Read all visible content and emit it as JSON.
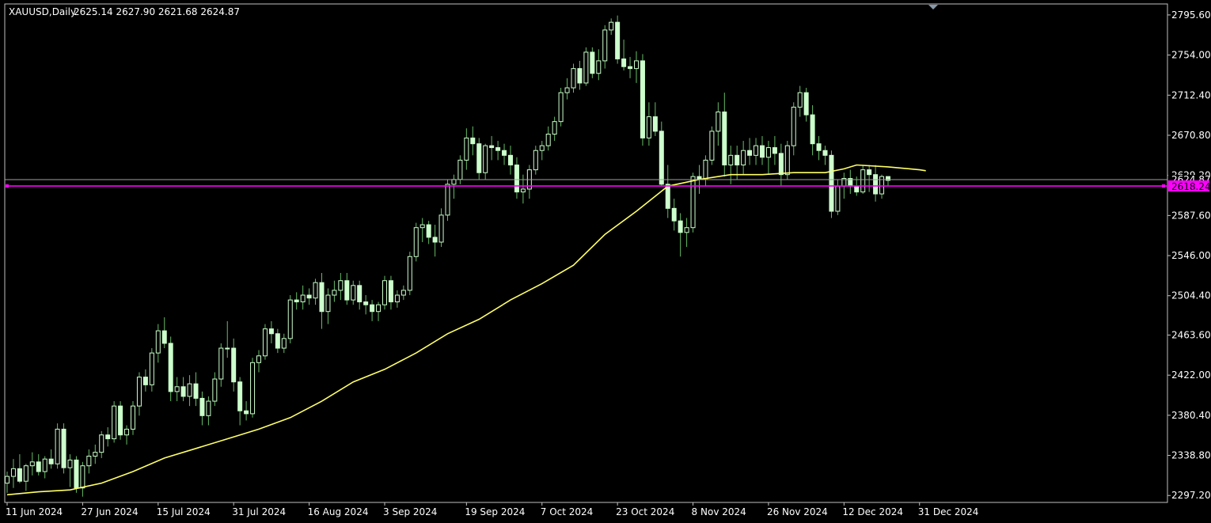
{
  "chart_data": {
    "type": "candlestick",
    "symbol": "XAUUSD",
    "timeframe": "Daily",
    "header_ohlc": {
      "open": "2625.14",
      "high": "2627.90",
      "low": "2621.68",
      "close": "2624.87"
    },
    "current_price": "2624.87",
    "horizontal_level": "2618.24",
    "y_ticks": [
      "2795.60",
      "2754.00",
      "2712.40",
      "2670.80",
      "2629.20",
      "2587.60",
      "2546.00",
      "2504.40",
      "2463.60",
      "2422.00",
      "2380.40",
      "2338.80",
      "2297.20"
    ],
    "x_ticks": [
      {
        "label": "11 Jun 2024",
        "index": 0
      },
      {
        "label": "27 Jun 2024",
        "index": 12
      },
      {
        "label": "15 Jul 2024",
        "index": 24
      },
      {
        "label": "31 Jul 2024",
        "index": 36
      },
      {
        "label": "16 Aug 2024",
        "index": 48
      },
      {
        "label": "3 Sep 2024",
        "index": 60
      },
      {
        "label": "19 Sep 2024",
        "index": 73
      },
      {
        "label": "7 Oct 2024",
        "index": 85
      },
      {
        "label": "23 Oct 2024",
        "index": 97
      },
      {
        "label": "8 Nov 2024",
        "index": 109
      },
      {
        "label": "26 Nov 2024",
        "index": 121
      },
      {
        "label": "12 Dec 2024",
        "index": 133
      },
      {
        "label": "31 Dec 2024",
        "index": 145
      }
    ],
    "ylim": [
      2290,
      2807
    ],
    "ohlc": [
      [
        2310,
        2322,
        2300,
        2317
      ],
      [
        2317,
        2335,
        2305,
        2325
      ],
      [
        2325,
        2340,
        2310,
        2312
      ],
      [
        2312,
        2330,
        2302,
        2328
      ],
      [
        2328,
        2342,
        2318,
        2332
      ],
      [
        2332,
        2340,
        2318,
        2322
      ],
      [
        2322,
        2338,
        2315,
        2335
      ],
      [
        2335,
        2345,
        2325,
        2330
      ],
      [
        2330,
        2372,
        2325,
        2366
      ],
      [
        2366,
        2372,
        2320,
        2326
      ],
      [
        2326,
        2340,
        2306,
        2334
      ],
      [
        2334,
        2338,
        2300,
        2305
      ],
      [
        2305,
        2332,
        2296,
        2328
      ],
      [
        2328,
        2345,
        2320,
        2338
      ],
      [
        2338,
        2350,
        2330,
        2342
      ],
      [
        2342,
        2364,
        2336,
        2360
      ],
      [
        2360,
        2368,
        2348,
        2356
      ],
      [
        2356,
        2395,
        2352,
        2390
      ],
      [
        2390,
        2395,
        2355,
        2360
      ],
      [
        2360,
        2370,
        2350,
        2366
      ],
      [
        2366,
        2395,
        2360,
        2390
      ],
      [
        2390,
        2425,
        2380,
        2420
      ],
      [
        2420,
        2428,
        2405,
        2412
      ],
      [
        2412,
        2450,
        2405,
        2445
      ],
      [
        2445,
        2475,
        2435,
        2468
      ],
      [
        2468,
        2482,
        2450,
        2455
      ],
      [
        2455,
        2462,
        2395,
        2405
      ],
      [
        2405,
        2420,
        2395,
        2410
      ],
      [
        2410,
        2420,
        2395,
        2400
      ],
      [
        2400,
        2422,
        2390,
        2413
      ],
      [
        2413,
        2425,
        2390,
        2398
      ],
      [
        2398,
        2405,
        2370,
        2380
      ],
      [
        2380,
        2400,
        2370,
        2395
      ],
      [
        2395,
        2425,
        2390,
        2418
      ],
      [
        2418,
        2455,
        2410,
        2450
      ],
      [
        2450,
        2478,
        2440,
        2450
      ],
      [
        2450,
        2460,
        2405,
        2415
      ],
      [
        2415,
        2420,
        2370,
        2385
      ],
      [
        2385,
        2395,
        2375,
        2382
      ],
      [
        2382,
        2440,
        2378,
        2435
      ],
      [
        2435,
        2448,
        2425,
        2442
      ],
      [
        2442,
        2475,
        2438,
        2470
      ],
      [
        2470,
        2478,
        2455,
        2465
      ],
      [
        2465,
        2470,
        2445,
        2450
      ],
      [
        2450,
        2465,
        2445,
        2460
      ],
      [
        2460,
        2505,
        2455,
        2500
      ],
      [
        2500,
        2508,
        2490,
        2498
      ],
      [
        2498,
        2515,
        2490,
        2505
      ],
      [
        2505,
        2512,
        2495,
        2502
      ],
      [
        2502,
        2522,
        2495,
        2518
      ],
      [
        2518,
        2528,
        2470,
        2488
      ],
      [
        2488,
        2512,
        2475,
        2505
      ],
      [
        2505,
        2520,
        2498,
        2510
      ],
      [
        2510,
        2528,
        2500,
        2520
      ],
      [
        2520,
        2528,
        2495,
        2500
      ],
      [
        2500,
        2520,
        2495,
        2515
      ],
      [
        2515,
        2520,
        2490,
        2498
      ],
      [
        2498,
        2505,
        2485,
        2495
      ],
      [
        2495,
        2500,
        2478,
        2488
      ],
      [
        2488,
        2498,
        2478,
        2495
      ],
      [
        2495,
        2525,
        2490,
        2520
      ],
      [
        2520,
        2525,
        2490,
        2498
      ],
      [
        2498,
        2510,
        2492,
        2505
      ],
      [
        2505,
        2515,
        2500,
        2510
      ],
      [
        2510,
        2550,
        2505,
        2545
      ],
      [
        2545,
        2580,
        2540,
        2575
      ],
      [
        2575,
        2585,
        2560,
        2578
      ],
      [
        2578,
        2582,
        2558,
        2565
      ],
      [
        2565,
        2578,
        2545,
        2560
      ],
      [
        2560,
        2595,
        2555,
        2588
      ],
      [
        2588,
        2625,
        2582,
        2620
      ],
      [
        2620,
        2630,
        2605,
        2625
      ],
      [
        2625,
        2650,
        2620,
        2645
      ],
      [
        2645,
        2678,
        2635,
        2668
      ],
      [
        2668,
        2680,
        2650,
        2662
      ],
      [
        2662,
        2668,
        2625,
        2632
      ],
      [
        2632,
        2662,
        2625,
        2660
      ],
      [
        2660,
        2670,
        2645,
        2658
      ],
      [
        2658,
        2665,
        2645,
        2655
      ],
      [
        2655,
        2662,
        2640,
        2650
      ],
      [
        2650,
        2660,
        2630,
        2640
      ],
      [
        2640,
        2648,
        2605,
        2612
      ],
      [
        2612,
        2630,
        2600,
        2615
      ],
      [
        2615,
        2640,
        2605,
        2635
      ],
      [
        2635,
        2660,
        2630,
        2655
      ],
      [
        2655,
        2665,
        2645,
        2660
      ],
      [
        2660,
        2680,
        2655,
        2672
      ],
      [
        2672,
        2690,
        2665,
        2685
      ],
      [
        2685,
        2720,
        2680,
        2715
      ],
      [
        2715,
        2730,
        2708,
        2720
      ],
      [
        2720,
        2745,
        2715,
        2740
      ],
      [
        2740,
        2748,
        2718,
        2725
      ],
      [
        2725,
        2762,
        2722,
        2757
      ],
      [
        2757,
        2762,
        2730,
        2735
      ],
      [
        2735,
        2760,
        2728,
        2748
      ],
      [
        2748,
        2785,
        2740,
        2780
      ],
      [
        2780,
        2792,
        2775,
        2788
      ],
      [
        2788,
        2795,
        2745,
        2750
      ],
      [
        2750,
        2770,
        2738,
        2742
      ],
      [
        2742,
        2752,
        2730,
        2740
      ],
      [
        2740,
        2758,
        2725,
        2748
      ],
      [
        2748,
        2755,
        2660,
        2668
      ],
      [
        2668,
        2705,
        2660,
        2690
      ],
      [
        2690,
        2705,
        2670,
        2675
      ],
      [
        2675,
        2685,
        2618,
        2620
      ],
      [
        2620,
        2640,
        2585,
        2595
      ],
      [
        2595,
        2605,
        2572,
        2582
      ],
      [
        2582,
        2590,
        2545,
        2570
      ],
      [
        2570,
        2585,
        2555,
        2575
      ],
      [
        2575,
        2632,
        2570,
        2628
      ],
      [
        2628,
        2640,
        2610,
        2625
      ],
      [
        2625,
        2650,
        2618,
        2645
      ],
      [
        2645,
        2680,
        2640,
        2675
      ],
      [
        2675,
        2705,
        2660,
        2695
      ],
      [
        2695,
        2715,
        2628,
        2640
      ],
      [
        2640,
        2660,
        2620,
        2650
      ],
      [
        2650,
        2660,
        2625,
        2640
      ],
      [
        2640,
        2665,
        2630,
        2655
      ],
      [
        2655,
        2668,
        2640,
        2650
      ],
      [
        2650,
        2668,
        2640,
        2660
      ],
      [
        2660,
        2670,
        2640,
        2648
      ],
      [
        2648,
        2665,
        2630,
        2658
      ],
      [
        2658,
        2670,
        2640,
        2652
      ],
      [
        2652,
        2662,
        2618,
        2630
      ],
      [
        2630,
        2665,
        2625,
        2660
      ],
      [
        2660,
        2705,
        2650,
        2700
      ],
      [
        2700,
        2722,
        2690,
        2715
      ],
      [
        2715,
        2720,
        2685,
        2692
      ],
      [
        2692,
        2702,
        2650,
        2662
      ],
      [
        2662,
        2670,
        2645,
        2655
      ],
      [
        2655,
        2660,
        2640,
        2650
      ],
      [
        2650,
        2655,
        2585,
        2592
      ],
      [
        2592,
        2625,
        2588,
        2618
      ],
      [
        2618,
        2632,
        2605,
        2626
      ],
      [
        2626,
        2635,
        2610,
        2618
      ],
      [
        2618,
        2628,
        2608,
        2612
      ],
      [
        2612,
        2640,
        2610,
        2635
      ],
      [
        2635,
        2640,
        2612,
        2630
      ],
      [
        2630,
        2640,
        2602,
        2610
      ],
      [
        2610,
        2630,
        2605,
        2628
      ],
      [
        2628,
        2628,
        2618,
        2624
      ]
    ],
    "ma": [
      [
        0,
        2298
      ],
      [
        5,
        2301
      ],
      [
        10,
        2303
      ],
      [
        15,
        2310
      ],
      [
        20,
        2322
      ],
      [
        25,
        2336
      ],
      [
        30,
        2346
      ],
      [
        35,
        2356
      ],
      [
        40,
        2366
      ],
      [
        45,
        2378
      ],
      [
        50,
        2395
      ],
      [
        55,
        2415
      ],
      [
        60,
        2428
      ],
      [
        65,
        2445
      ],
      [
        70,
        2465
      ],
      [
        75,
        2480
      ],
      [
        80,
        2500
      ],
      [
        85,
        2517
      ],
      [
        90,
        2536
      ],
      [
        95,
        2568
      ],
      [
        100,
        2592
      ],
      [
        105,
        2618
      ],
      [
        110,
        2625
      ],
      [
        115,
        2630
      ],
      [
        120,
        2630
      ],
      [
        125,
        2632
      ],
      [
        130,
        2632
      ],
      [
        133,
        2636
      ],
      [
        135,
        2640
      ],
      [
        140,
        2638
      ],
      [
        145,
        2635
      ],
      [
        146,
        2634
      ]
    ]
  },
  "colors": {
    "background": "#000000",
    "bull_candle": "#ccffcc",
    "bear_candle": "#ccffcc",
    "wick": "#66bb66",
    "ma_line": "#ffff66",
    "level_line": "#ff00ff",
    "price_line": "#a0a0a0",
    "axis_text": "#ffffff"
  }
}
